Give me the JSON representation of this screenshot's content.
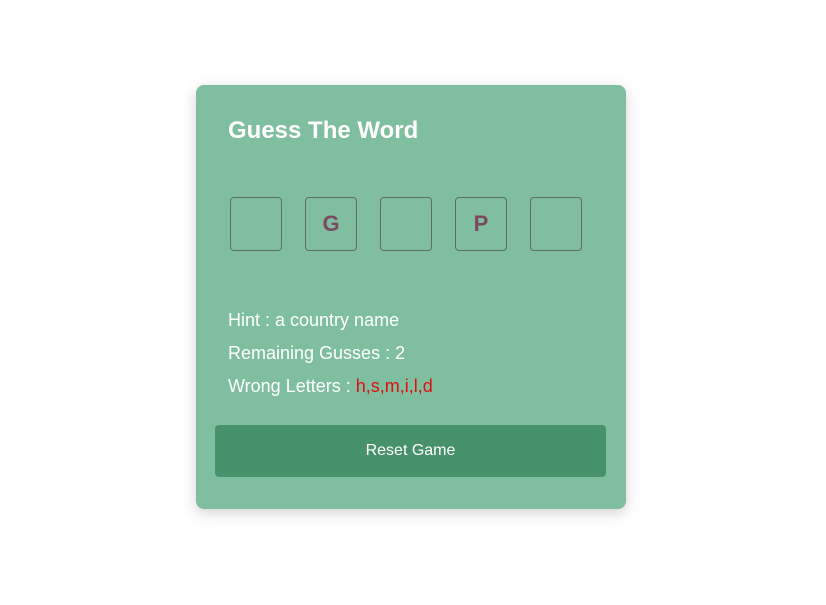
{
  "game": {
    "title": "Guess The Word",
    "letters": [
      "",
      "G",
      "",
      "P",
      ""
    ],
    "hint_label": "Hint : ",
    "hint_value": "a country name",
    "remaining_label": "Remaining Gusses : ",
    "remaining_value": "2",
    "wrong_label": "Wrong Letters : ",
    "wrong_value": "h,s,m,i,l,d",
    "reset_label": "Reset Game"
  },
  "colors": {
    "card": "#80bea0",
    "button": "#48926b",
    "letter": "#7a4a60",
    "wrong": "#e01010"
  }
}
